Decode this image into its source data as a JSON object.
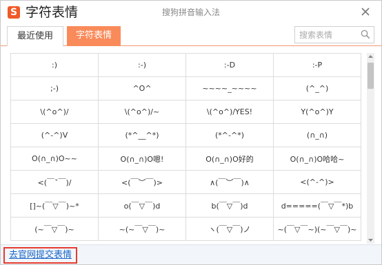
{
  "window": {
    "title": "字符表情",
    "subtitle": "搜狗拼音输入法",
    "logo_letter": "S",
    "accent_color": "#f98b5a"
  },
  "tabs": [
    {
      "label": "最近使用",
      "active": false
    },
    {
      "label": "字符表情",
      "active": true
    }
  ],
  "search": {
    "placeholder": "搜索表情"
  },
  "emoticons": [
    [
      ":)",
      ":-)",
      ":-D",
      ":-P"
    ],
    [
      ";-)",
      "^O^",
      "~~~~_~~~~",
      "(^_^)"
    ],
    [
      "\\(^o^)/",
      "\\(^o^)/~",
      "\\(^o^)/YES!",
      "Y(^o^)Y"
    ],
    [
      "(^-^)V",
      "(*^__^*)",
      "(*^-^*)",
      "(∩_∩)"
    ],
    [
      "O(∩_∩)O~~",
      "O(∩_∩)O嗯!",
      "O(∩_∩)O好的",
      "O(∩_∩)O哈哈~"
    ],
    [
      "<(￣ˇ￣)/",
      "<(￣︶￣)>",
      "∧(￣︶￣)∧",
      "<(^-^)>"
    ],
    [
      "[]~(￣▽￣)~*",
      "o(￣▽￣)d",
      "b(￣▽￣)d",
      "d=====(￣▽￣*)b"
    ],
    [
      "(~￣▽￣)~",
      "~(~￣▽￣)~",
      "ヽ(￣▽￣)ノ",
      "~(￣▽￣~)(~￣▽￣)~"
    ]
  ],
  "footer": {
    "link_label": "去官网提交表情"
  }
}
